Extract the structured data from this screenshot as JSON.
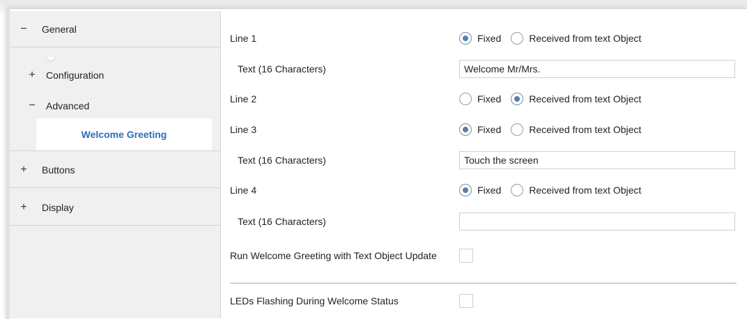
{
  "sidebar": {
    "items": [
      {
        "sign": "−",
        "label": "General"
      },
      {
        "sign": "+",
        "label": "Configuration"
      },
      {
        "sign": "−",
        "label": "Advanced"
      },
      {
        "sign": "",
        "label": "Welcome Greeting"
      },
      {
        "sign": "+",
        "label": "Buttons"
      },
      {
        "sign": "+",
        "label": "Display"
      }
    ]
  },
  "main": {
    "line1": {
      "label": "Line 1",
      "options": [
        "Fixed",
        "Received from text Object"
      ],
      "selected": "Fixed"
    },
    "line1_text": {
      "label": "Text (16 Characters)",
      "value": "Welcome Mr/Mrs."
    },
    "line2": {
      "label": "Line 2",
      "options": [
        "Fixed",
        "Received from text Object"
      ],
      "selected": "Received from text Object"
    },
    "line3": {
      "label": "Line 3",
      "options": [
        "Fixed",
        "Received from text Object"
      ],
      "selected": "Fixed"
    },
    "line3_text": {
      "label": "Text (16 Characters)",
      "value": "Touch the screen"
    },
    "line4": {
      "label": "Line 4",
      "options": [
        "Fixed",
        "Received from text Object"
      ],
      "selected": "Fixed"
    },
    "line4_text": {
      "label": "Text (16 Characters)",
      "value": ""
    },
    "run_update": {
      "label": "Run Welcome Greeting with Text Object Update",
      "checked": false
    },
    "leds_flashing": {
      "label": "LEDs Flashing During Welcome Status",
      "checked": false
    }
  },
  "colors": {
    "accent": "#2a6ebb",
    "radio_fill": "#5a7ea8",
    "sidebar_bg": "#f0f0f0"
  }
}
